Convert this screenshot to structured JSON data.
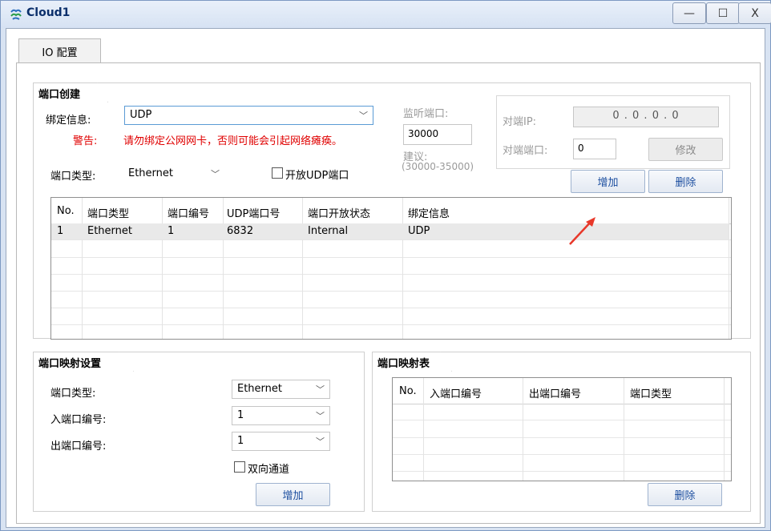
{
  "window": {
    "title": "Cloud1",
    "minimize": "—",
    "maximize": "☐",
    "close": "X"
  },
  "tabs": [
    {
      "label": "IO 配置",
      "active": true
    }
  ],
  "port_creation": {
    "section_title": "端口创建",
    "binding_label": "绑定信息:",
    "binding_value": "UDP",
    "warning_label": "警告:",
    "warning_text": "请勿绑定公网网卡，否则可能会引起网络瘫痪。",
    "port_type_label": "端口类型:",
    "port_type_value": "Ethernet",
    "open_udp_label": "开放UDP端口",
    "open_udp_checked": false,
    "listen_port_label": "监听端口:",
    "listen_port_value": "30000",
    "suggest_label": "建议:",
    "suggest_range": "(30000-35000)",
    "peer_ip_label": "对端IP:",
    "peer_ip_value": "0 . 0 . 0 . 0",
    "peer_port_label": "对端端口:",
    "peer_port_value": "0",
    "modify_button": "修改",
    "add_button": "增加",
    "delete_button": "删除",
    "table": {
      "columns": [
        "No.",
        "端口类型",
        "端口编号",
        "UDP端口号",
        "端口开放状态",
        "绑定信息"
      ],
      "rows": [
        [
          "1",
          "Ethernet",
          "1",
          "6832",
          "Internal",
          "UDP"
        ]
      ]
    }
  },
  "port_mapping_settings": {
    "section_title": "端口映射设置",
    "port_type_label": "端口类型:",
    "port_type_value": "Ethernet",
    "in_port_label": "入端口编号:",
    "in_port_value": "1",
    "out_port_label": "出端口编号:",
    "out_port_value": "1",
    "bidirectional_label": "双向通道",
    "bidirectional_checked": false,
    "add_button": "增加"
  },
  "port_mapping_table": {
    "section_title": "端口映射表",
    "columns": [
      "No.",
      "入端口编号",
      "出端口编号",
      "端口类型"
    ],
    "delete_button": "删除"
  },
  "colors": {
    "accent": "#1d4fa0",
    "warning": "#e00000",
    "annotation_arrow": "#e8382a",
    "titlebar": "#d6e2f3"
  }
}
